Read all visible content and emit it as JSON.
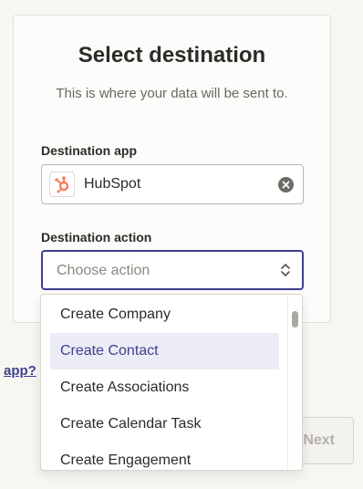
{
  "card": {
    "title": "Select destination",
    "subtitle": "This is where your data will be sent to."
  },
  "destination_app": {
    "label": "Destination app",
    "value": "HubSpot",
    "icon": "hubspot-icon",
    "brand_color": "#ff7a59"
  },
  "destination_action": {
    "label": "Destination action",
    "placeholder": "Choose action"
  },
  "dropdown": {
    "options": [
      {
        "label": "Create Company"
      },
      {
        "label": "Create Contact"
      },
      {
        "label": "Create Associations"
      },
      {
        "label": "Create Calendar Task"
      },
      {
        "label": "Create Engagement"
      }
    ],
    "highlighted": "Create Contact"
  },
  "footer": {
    "side_link": "app?",
    "next_label": "Next"
  },
  "colors": {
    "accent": "#3d3f8f",
    "highlight_bg": "#ececf6",
    "page_bg": "#f8f6f1"
  }
}
